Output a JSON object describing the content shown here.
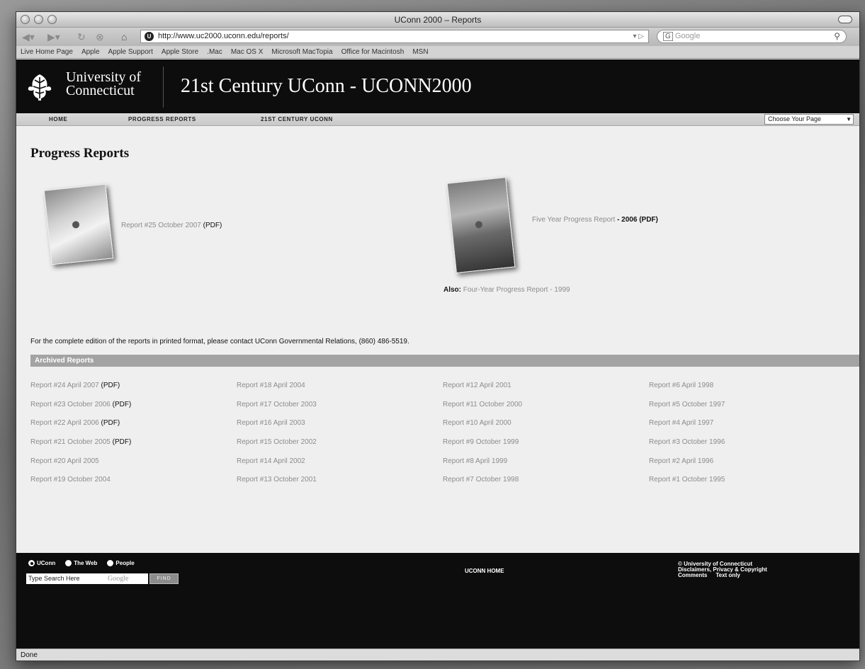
{
  "window": {
    "title": "UConn 2000 – Reports"
  },
  "toolbar": {
    "url": "http://www.uc2000.uconn.edu/reports/",
    "search_placeholder": "Google",
    "search_engine_badge": "G"
  },
  "bookmarks": [
    "Live Home Page",
    "Apple",
    "Apple Support",
    "Apple Store",
    ".Mac",
    "Mac OS X",
    "Microsoft MacTopia",
    "Office for Macintosh",
    "MSN"
  ],
  "header": {
    "logo_line1": "University of",
    "logo_line2": "Connecticut",
    "site_title": "21st Century UConn - UCONN2000"
  },
  "nav": {
    "home": "HOME",
    "progress": "PROGRESS REPORTS",
    "century": "21ST CENTURY UCONN",
    "choose": "Choose Your Page"
  },
  "main": {
    "title": "Progress Reports",
    "featured1": {
      "link": "Report #25 October 2007",
      "pdf": "(PDF)"
    },
    "featured2": {
      "link": "Five Year Progress Report",
      "suffix": "- 2006 (PDF)"
    },
    "also_label": "Also:",
    "also_link": "Four-Year Progress Report - 1999",
    "contact": "For the complete edition of the reports in printed format, please contact UConn Governmental Relations, (860) 486-5519."
  },
  "archive": {
    "heading": "Archived Reports",
    "items": [
      {
        "label": "Report #24 April 2007",
        "pdf": "(PDF)"
      },
      {
        "label": "Report #18 April 2004",
        "pdf": ""
      },
      {
        "label": "Report #12 April 2001",
        "pdf": ""
      },
      {
        "label": "Report #6 April 1998",
        "pdf": ""
      },
      {
        "label": "Report #23 October 2006",
        "pdf": "(PDF)"
      },
      {
        "label": "Report #17 October 2003",
        "pdf": ""
      },
      {
        "label": "Report #11 October 2000",
        "pdf": ""
      },
      {
        "label": "Report #5 October 1997",
        "pdf": ""
      },
      {
        "label": "Report #22 April 2006",
        "pdf": "(PDF)"
      },
      {
        "label": "Report #16 April 2003",
        "pdf": ""
      },
      {
        "label": "Report #10 April 2000",
        "pdf": ""
      },
      {
        "label": "Report #4 April 1997",
        "pdf": ""
      },
      {
        "label": "Report #21 October 2005",
        "pdf": "(PDF)"
      },
      {
        "label": "Report #15 October 2002",
        "pdf": ""
      },
      {
        "label": "Report #9 October 1999",
        "pdf": ""
      },
      {
        "label": "Report #3 October 1996",
        "pdf": ""
      },
      {
        "label": "Report #20 April 2005",
        "pdf": ""
      },
      {
        "label": "Report #14 April 2002",
        "pdf": ""
      },
      {
        "label": "Report #8 April 1999",
        "pdf": ""
      },
      {
        "label": "Report #2 April 1996",
        "pdf": ""
      },
      {
        "label": "Report #19 October 2004",
        "pdf": ""
      },
      {
        "label": "Report #13 October 2001",
        "pdf": ""
      },
      {
        "label": "Report #7 October 1998",
        "pdf": ""
      },
      {
        "label": "Report #1 October 1995",
        "pdf": ""
      }
    ]
  },
  "footer": {
    "radio_uconn": "UConn",
    "radio_web": "The Web",
    "radio_people": "People",
    "search_placeholder": "Type Search Here",
    "google": "Google",
    "find": "FIND",
    "uconn_home": "UCONN HOME",
    "copyright": "© University of Connecticut",
    "disclaimers": "Disclaimers, Privacy & Copyright",
    "comments": "Comments",
    "text_only": "Text only"
  },
  "status": "Done"
}
